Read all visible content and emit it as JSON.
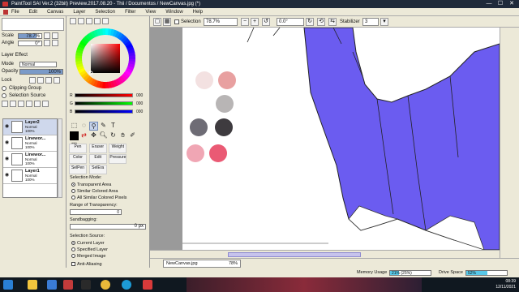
{
  "window": {
    "title": "PaintTool SAI Ver.2 (32bit) Preview.2017.08.20 - Thii / Documentos / NewCanvas.jpg (*)",
    "buttons": [
      "—",
      "☐",
      "✕"
    ]
  },
  "menu": [
    "File",
    "Edit",
    "Canvas",
    "Layer",
    "Selection",
    "Filter",
    "View",
    "Window",
    "Help"
  ],
  "toolbar": {
    "selection_label": "Selection",
    "zoom": "78.7%",
    "rotation": "0.0°",
    "stabilizer_label": "Stabilizer",
    "stabilizer_value": "3"
  },
  "left_panel": {
    "scale_label": "Scale",
    "scale_value": "78.7%",
    "angle_label": "Angle",
    "angle_value": "0°",
    "layer_effect": "Layer Effect",
    "mode_label": "Mode",
    "mode_value": "Normal",
    "opacity_label": "Opacity",
    "opacity_value": "100%",
    "lock_label": "Lock",
    "clipping_group": "Clipping Group",
    "selection_source": "Selection Source",
    "layers": [
      {
        "name": "Layer2",
        "mode": "Normal",
        "opacity": "100%",
        "selected": true
      },
      {
        "name": "Linewor...",
        "mode": "Normal",
        "opacity": "100%",
        "selected": false
      },
      {
        "name": "Linewor...",
        "mode": "Normal",
        "opacity": "100%",
        "selected": false
      },
      {
        "name": "Layer1",
        "mode": "Normal",
        "opacity": "100%",
        "selected": false
      }
    ]
  },
  "color": {
    "rgb": [
      {
        "label": "R",
        "value": "000"
      },
      {
        "label": "G",
        "value": "000"
      },
      {
        "label": "B",
        "value": "000"
      }
    ],
    "current": "#000000"
  },
  "brushes": [
    "Pen",
    "Eraser",
    "Weight",
    "Color",
    "Edit",
    "Pressure",
    "SelPen",
    "SelEra"
  ],
  "selection_panel": {
    "mode_label": "Selection Mode:",
    "modes": [
      "Transparent Area",
      "Similar Colored Area",
      "All Similar Colored Pixels"
    ],
    "mode_selected": 0,
    "range_label": "Range of Transparency:",
    "range_value": "0",
    "sandbagging_label": "Sandbagging:",
    "sandbagging_value": "0 px",
    "source_label": "Selection Source:",
    "sources": [
      "Current Layer",
      "Specified Layer",
      "Merged Image"
    ],
    "source_selected": 0,
    "anti_aliasing": "Anti-Aliasing"
  },
  "doc_tab": {
    "name": "NewCanvas.jpg",
    "zoom": "78%"
  },
  "status": {
    "memory_label": "Memory Usage",
    "memory_value": "21% (25%)",
    "memory_fraction": 0.21,
    "drive_label": "Drive Space",
    "drive_value": "52%",
    "drive_fraction": 0.52
  },
  "tray": {
    "time": "08:39",
    "date": "12/11/2021"
  },
  "palette_colors": [
    "#f3e1e1",
    "#e8a0a0",
    "#b8b5b5",
    "#6e6c75",
    "#3e3b3f",
    "#f0a6b4",
    "#ea5a74"
  ],
  "accent_purple": "#6b5cf0"
}
